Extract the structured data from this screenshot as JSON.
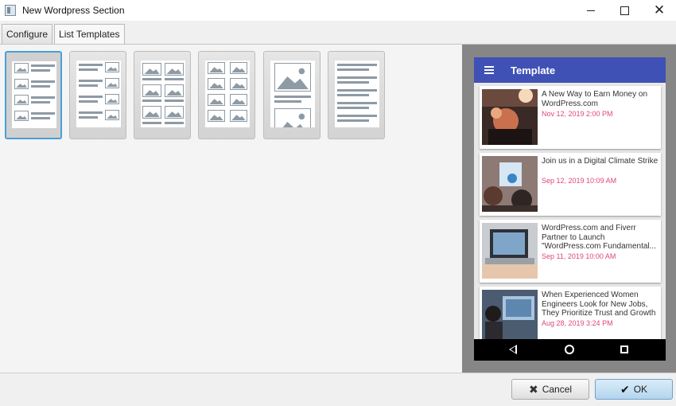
{
  "window": {
    "title": "New Wordpress Section",
    "minimize_icon": "minimize-icon",
    "maximize_icon": "maximize-icon",
    "close_symbol": "✕"
  },
  "tabs": [
    {
      "label": "Configure",
      "active": false
    },
    {
      "label": "List Templates",
      "active": true
    }
  ],
  "templates": [
    {
      "name": "list-image-left",
      "selected": true
    },
    {
      "name": "list-image-right",
      "selected": false
    },
    {
      "name": "grid-two-columns",
      "selected": false
    },
    {
      "name": "grid-two-columns-dense",
      "selected": false
    },
    {
      "name": "large-image-cards",
      "selected": false
    },
    {
      "name": "text-only-list",
      "selected": false
    }
  ],
  "preview": {
    "app_title": "Template",
    "accent_color": "#3f51b5",
    "date_color": "#e0457b",
    "posts": [
      {
        "title": "A New Way to Earn Money on WordPress.com",
        "date": "Nov 12, 2019 2:00 PM"
      },
      {
        "title": "Join us in a Digital Climate Strike",
        "date": "Sep 12, 2019 10:09 AM"
      },
      {
        "title": "WordPress.com and Fiverr Partner to Launch \"WordPress.com Fundamental...",
        "date": "Sep 11, 2019 10:00 AM"
      },
      {
        "title": "When Experienced Women Engineers Look for New Jobs, They Prioritize Trust and Growth",
        "date": "Aug 28, 2019 3:24 PM"
      }
    ]
  },
  "buttons": {
    "cancel": "Cancel",
    "cancel_icon": "✖",
    "ok": "OK",
    "ok_icon": "✔"
  }
}
